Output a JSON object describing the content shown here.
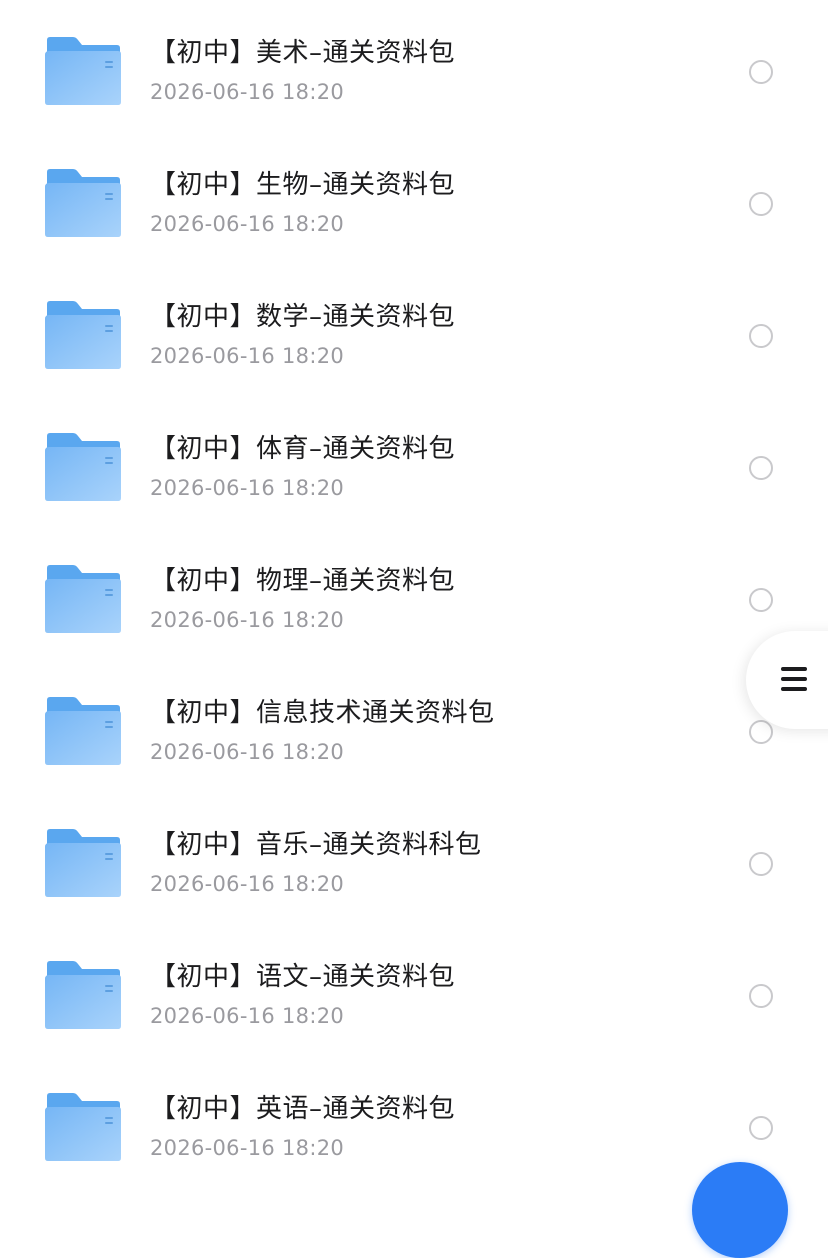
{
  "files": [
    {
      "name": "【初中】美术–通关资料包",
      "date": "2026-06-16 18:20",
      "icon": "folder-icon"
    },
    {
      "name": "【初中】生物–通关资料包",
      "date": "2026-06-16 18:20",
      "icon": "folder-icon"
    },
    {
      "name": "【初中】数学–通关资料包",
      "date": "2026-06-16 18:20",
      "icon": "folder-icon"
    },
    {
      "name": "【初中】体育–通关资料包",
      "date": "2026-06-16 18:20",
      "icon": "folder-icon"
    },
    {
      "name": "【初中】物理–通关资料包",
      "date": "2026-06-16 18:20",
      "icon": "folder-icon"
    },
    {
      "name": "【初中】信息技术通关资料包",
      "date": "2026-06-16 18:20",
      "icon": "folder-icon"
    },
    {
      "name": "【初中】音乐–通关资料科包",
      "date": "2026-06-16 18:20",
      "icon": "folder-icon"
    },
    {
      "name": "【初中】语文–通关资料包",
      "date": "2026-06-16 18:20",
      "icon": "folder-icon"
    },
    {
      "name": "【初中】英语–通关资料包",
      "date": "2026-06-16 18:20",
      "icon": "folder-icon"
    }
  ],
  "side_handle": {
    "icon": "menu-icon"
  },
  "fab": {
    "icon": "add-icon"
  },
  "colors": {
    "folder_back": "#5aa7ef",
    "folder_front": "#8cc3f7",
    "name_text": "#1c1c1e",
    "date_text": "#9a9a9f",
    "radio_border": "#c9c9cc",
    "accent": "#2b7cf6"
  }
}
